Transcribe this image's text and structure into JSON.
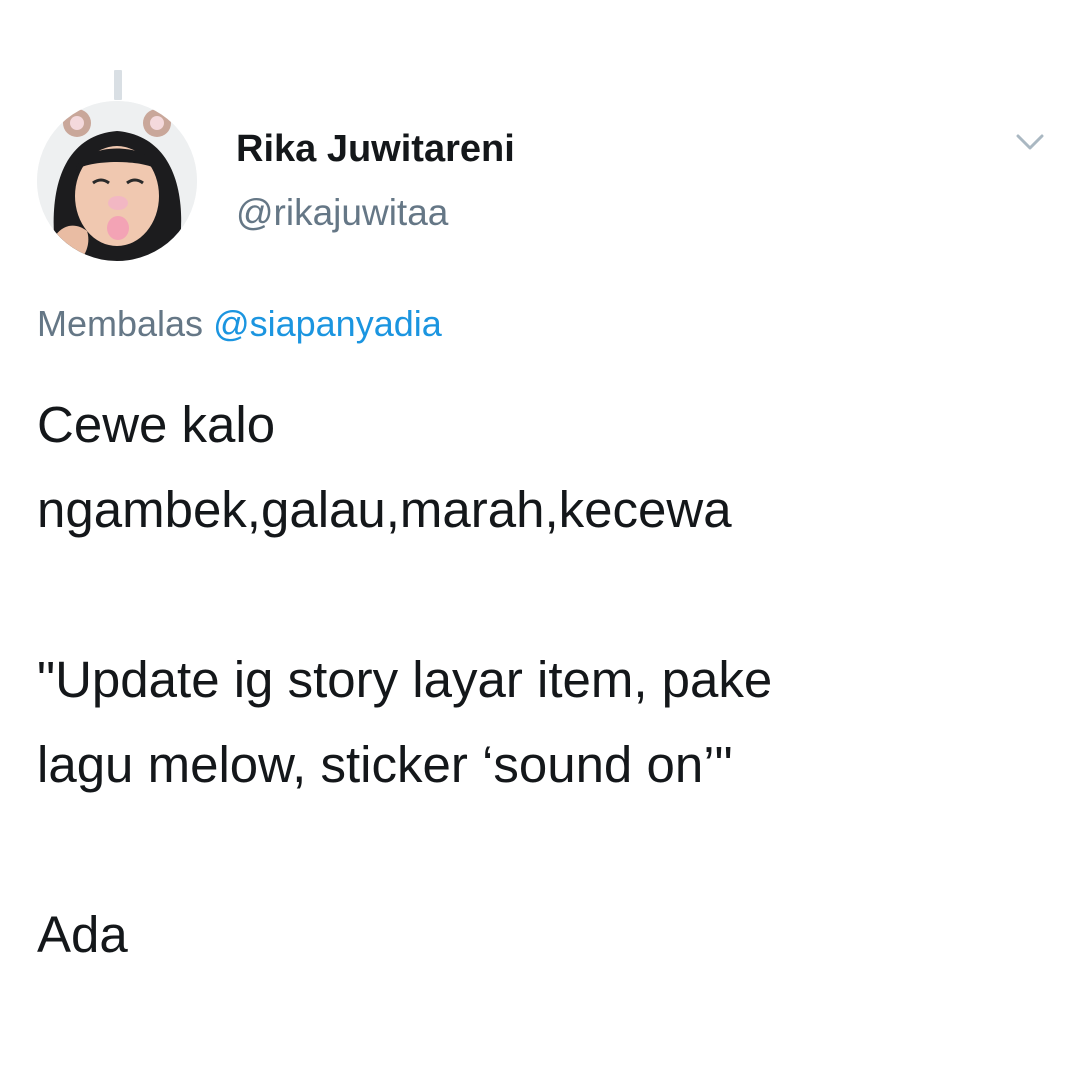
{
  "tweet": {
    "author": {
      "display_name": "Rika Juwitareni",
      "handle": "@rikajuwitaa",
      "avatar_icon": "profile-photo"
    },
    "menu_icon": "chevron-down-icon",
    "reply": {
      "prefix": "Membalas",
      "mention": "@siapanyadia"
    },
    "text": {
      "line1": "Cewe kalo",
      "line2": "ngambek,galau,marah,kecewa",
      "line3": "\"Update ig story layar item, pake",
      "line4": "lagu melow, sticker ‘sound on’\"",
      "line5": "Ada"
    }
  },
  "colors": {
    "text_primary": "#14171a",
    "text_secondary": "#657786",
    "mention": "#1b95e0",
    "thread_line": "#d9dfe4",
    "chevron": "#aab8c2"
  }
}
